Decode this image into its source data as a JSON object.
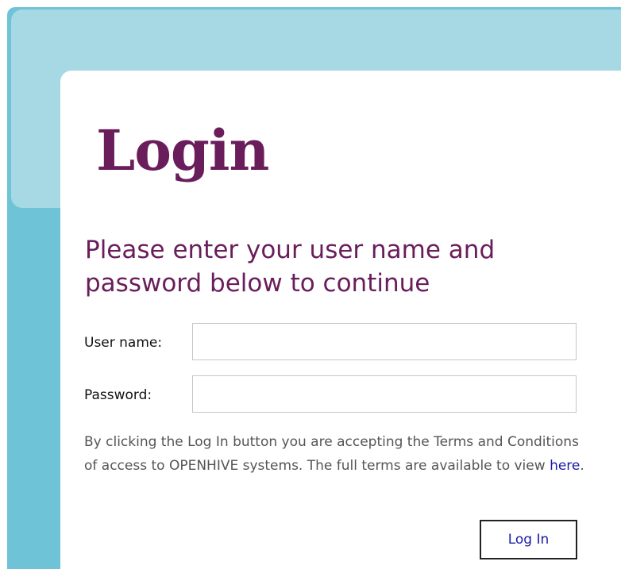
{
  "page": {
    "title": "Login",
    "subtitle": "Please enter your user name and password below to continue"
  },
  "form": {
    "username_label": "User name:",
    "username_value": "",
    "password_label": "Password:",
    "password_value": "",
    "submit_label": "Log In"
  },
  "terms": {
    "text_before": "By clicking the Log In button you are accepting the Terms and Conditions of access to OPENHIVE systems. The full terms are available to view ",
    "link_label": "here",
    "text_after": "."
  },
  "colors": {
    "heading": "#6a1d5b",
    "background_teal": "#6ec4d6",
    "background_light": "#a7d9e4",
    "link": "#1a1aa6"
  }
}
